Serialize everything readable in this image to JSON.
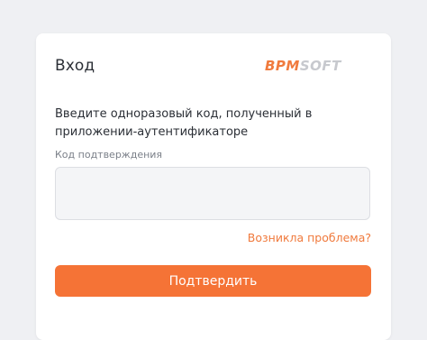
{
  "login": {
    "title": "Вход",
    "logo_part1": "BPM",
    "logo_part2": "SOFT",
    "instruction": "Введите одноразовый код, полученный в приложении-аутентификаторе",
    "code_label": "Код подтверждения",
    "code_value": "",
    "problem_link": "Возникла проблема?",
    "confirm_label": "Подтвердить"
  },
  "colors": {
    "accent": "#f57336",
    "background": "#eff0f3",
    "card": "#ffffff"
  }
}
